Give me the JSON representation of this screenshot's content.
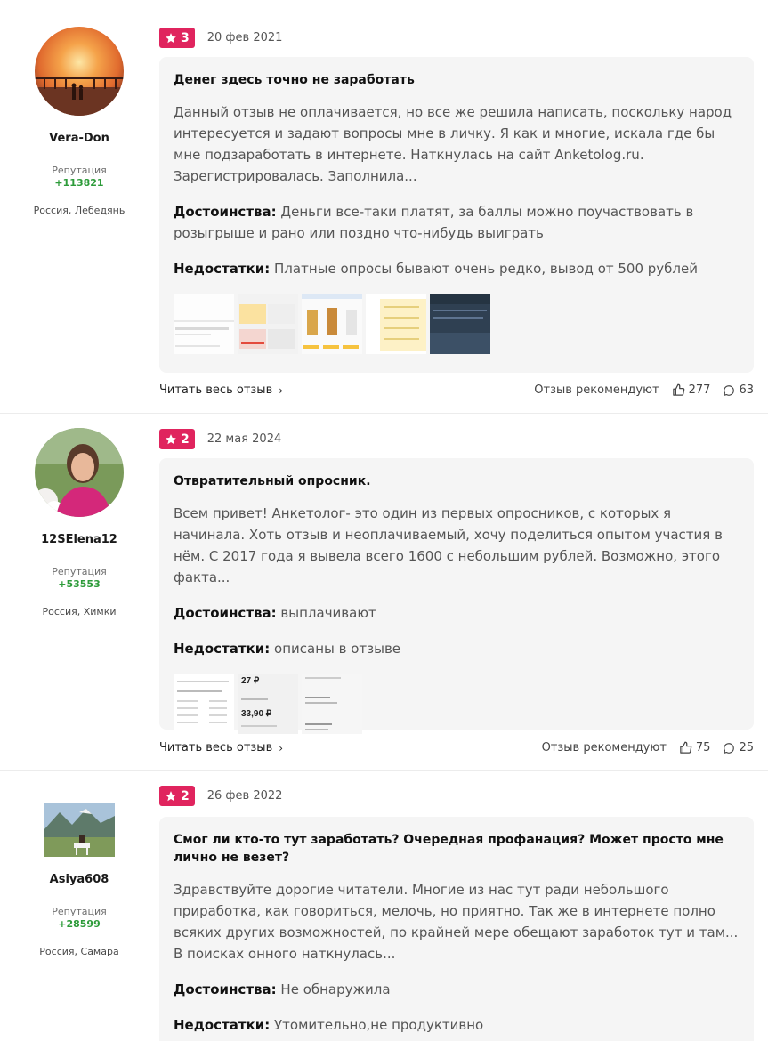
{
  "reviews": [
    {
      "author": "Vera-Don",
      "reputation_label": "Репутация",
      "reputation": "+113821",
      "location": "Россия, Лебедянь",
      "rating": "3",
      "date": "20 фев 2021",
      "title": "Денег здесь точно не заработать",
      "text": "Данный отзыв не оплачивается, но все же решила написать, поскольку народ интересуется и задают вопросы мне в личку. Я как и многие, искала где бы мне подзаработать в интернете. Наткнулась на сайт Anketolog.ru. Зарегистрировалась. Заполнила...",
      "pros_label": "Достоинства:",
      "pros": "Деньги все-таки платят, за баллы можно поучаствовать в розыгрыше и рано или поздно что-нибудь выиграть",
      "cons_label": "Недостатки:",
      "cons": "Платные опросы бывают очень редко, вывод от 500 рублей",
      "read_more": "Читать весь отзыв",
      "recommend_label": "Отзыв рекомендуют",
      "likes": "277",
      "comments": "63"
    },
    {
      "author": "12SElena12",
      "reputation_label": "Репутация",
      "reputation": "+53553",
      "location": "Россия, Химки",
      "rating": "2",
      "date": "22 мая 2024",
      "title": "Отвратительный опросник.",
      "text": "Всем привет! Анкетолог- это один из первых опросников, с которых я начинала. Хоть отзыв и неоплачиваемый, хочу поделиться опытом участия в нём. С 2017 года я вывела всего 1600 с небольшим рублей. Возможно, этого факта...",
      "pros_label": "Достоинства:",
      "pros": "выплачивают",
      "cons_label": "Недостатки:",
      "cons": "описаны в отзыве",
      "read_more": "Читать весь отзыв",
      "recommend_label": "Отзыв рекомендуют",
      "likes": "75",
      "comments": "25",
      "thumb_texts": [
        "27 ₽",
        "33,90 ₽"
      ]
    },
    {
      "author": "Asiya608",
      "reputation_label": "Репутация",
      "reputation": "+28599",
      "location": "Россия, Самара",
      "rating": "2",
      "date": "26 фев 2022",
      "title": "Смог ли кто-то тут заработать? Очередная профанация? Может просто мне лично не везет?",
      "text": "Здравствуйте дорогие читатели. Многие из нас тут ради небольшого приработка, как говориться, мелочь, но приятно. Так же в интернете полно всяких других возможностей, по крайней мере обещают заработок тут и там... В поисках онного наткнулась...",
      "pros_label": "Достоинства:",
      "pros": "Не обнаружила",
      "cons_label": "Недостатки:",
      "cons": "Утомительно,не продуктивно"
    }
  ],
  "colors": {
    "badge": "#e0245e",
    "reputation": "#2d9b3a",
    "card": "#f5f5f5"
  },
  "icons": {
    "rating": "star-icon",
    "read_more": "chevron-right-icon",
    "likes": "thumbs-up-icon",
    "comments": "comment-icon"
  }
}
